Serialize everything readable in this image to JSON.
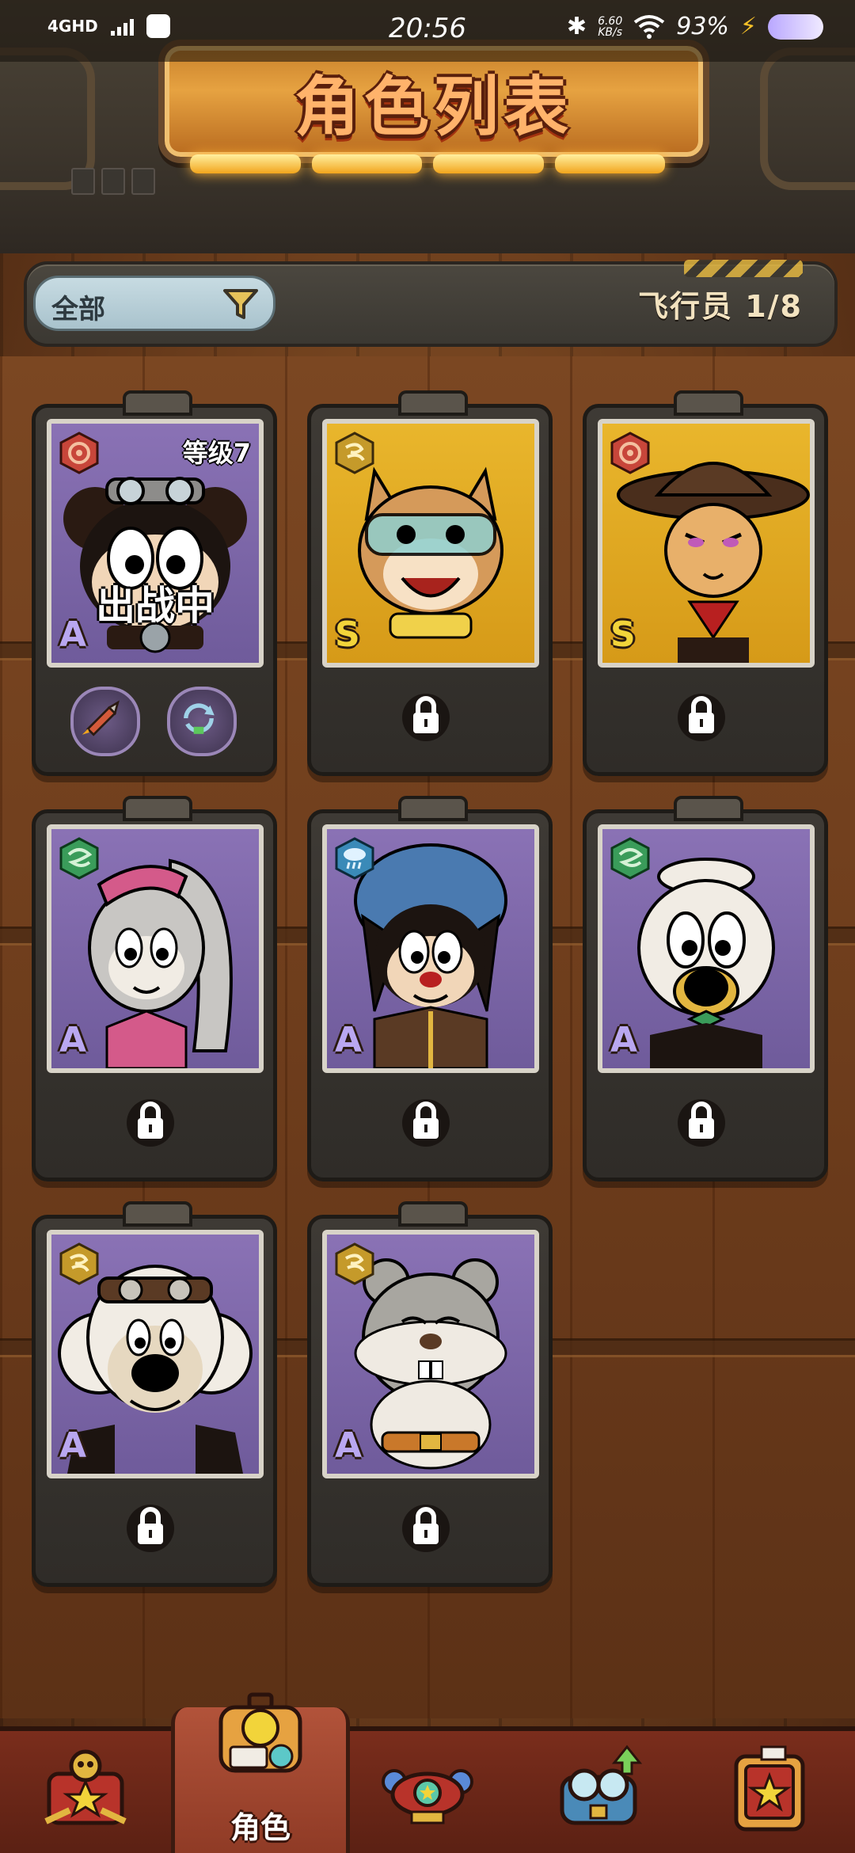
{
  "status_bar": {
    "network": "4GHD",
    "time": "20:56",
    "speed_value": "6.60",
    "speed_unit": "KB/s",
    "battery": "93%"
  },
  "header": {
    "title": "角色列表"
  },
  "filter": {
    "label": "全部",
    "icon": "funnel-icon",
    "pilot_count": "飞行员 1/8"
  },
  "characters": [
    {
      "id": "mouse-pilot",
      "rank": "A",
      "element": "gear",
      "element_color": "#c8463a",
      "background": "purple",
      "unlocked": true,
      "level_label": "等级7",
      "deployed_label": "出战中",
      "equip_slots": [
        "rocket-icon",
        "refresh-icon"
      ]
    },
    {
      "id": "squirrel-goggles",
      "rank": "S",
      "element": "wind-swirl",
      "element_color": "#c59a2a",
      "background": "yellow",
      "unlocked": false
    },
    {
      "id": "cat-cowgirl",
      "rank": "S",
      "element": "gear",
      "element_color": "#c8463a",
      "background": "yellow",
      "unlocked": false
    },
    {
      "id": "girl-ponytail",
      "rank": "A",
      "element": "cyclone",
      "element_color": "#3a9c5a",
      "background": "purple",
      "unlocked": false
    },
    {
      "id": "dog-helmet",
      "rank": "A",
      "element": "cloud-rain",
      "element_color": "#3a8ab8",
      "background": "purple",
      "unlocked": false
    },
    {
      "id": "duck-sailor",
      "rank": "A",
      "element": "cyclone",
      "element_color": "#3a9c5a",
      "background": "purple",
      "unlocked": false
    },
    {
      "id": "sheep-aviator",
      "rank": "A",
      "element": "wind-swirl",
      "element_color": "#c59a2a",
      "background": "purple",
      "unlocked": false
    },
    {
      "id": "hamster-belt",
      "rank": "A",
      "element": "wind-swirl",
      "element_color": "#c59a2a",
      "background": "purple",
      "unlocked": false
    }
  ],
  "bottom_nav": [
    {
      "id": "missions",
      "label": "",
      "icon": "treasure-star-icon",
      "active": false
    },
    {
      "id": "characters",
      "label": "角色",
      "icon": "character-chest-icon",
      "active": true
    },
    {
      "id": "aircraft",
      "label": "",
      "icon": "airship-icon",
      "active": false
    },
    {
      "id": "upgrade",
      "label": "",
      "icon": "goggles-upgrade-icon",
      "active": false
    },
    {
      "id": "collection",
      "label": "",
      "icon": "star-album-icon",
      "active": false
    }
  ]
}
